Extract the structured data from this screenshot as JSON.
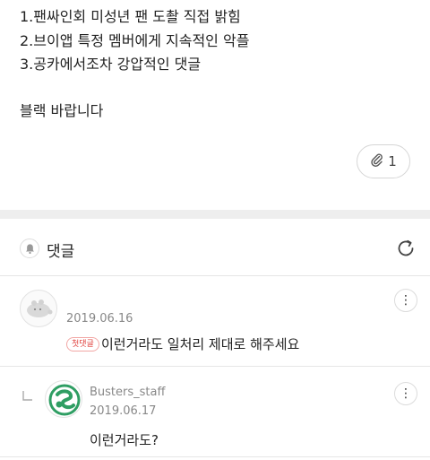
{
  "post": {
    "lines": [
      "1.팬싸인회 미성년 팬 도촬 직접 밝힘",
      "2.브이앱 특정 멤버에게 지속적인 악플",
      "3.공카에서조차 강압적인 댓글"
    ],
    "closing": "블랙 바랍니다",
    "attachment": {
      "icon": "paperclip-icon",
      "count": "1"
    }
  },
  "comments_section": {
    "title": "댓글",
    "icon": "bell-icon",
    "refresh_icon": "refresh-icon"
  },
  "comments": [
    {
      "date": "2019.06.16",
      "badge": "첫댓글",
      "text": "이런거라도 일처리 제대로 해주세요",
      "more_icon": "more-vertical-icon"
    },
    {
      "author": "Busters_staff",
      "date": "2019.06.17",
      "text": "이런거라도?",
      "reply_icon": "reply-arrow-icon",
      "more_icon": "more-vertical-icon"
    }
  ],
  "colors": {
    "badge": "#e0423e",
    "logo_green": "#2f9e63",
    "separator": "#eeeeee"
  }
}
